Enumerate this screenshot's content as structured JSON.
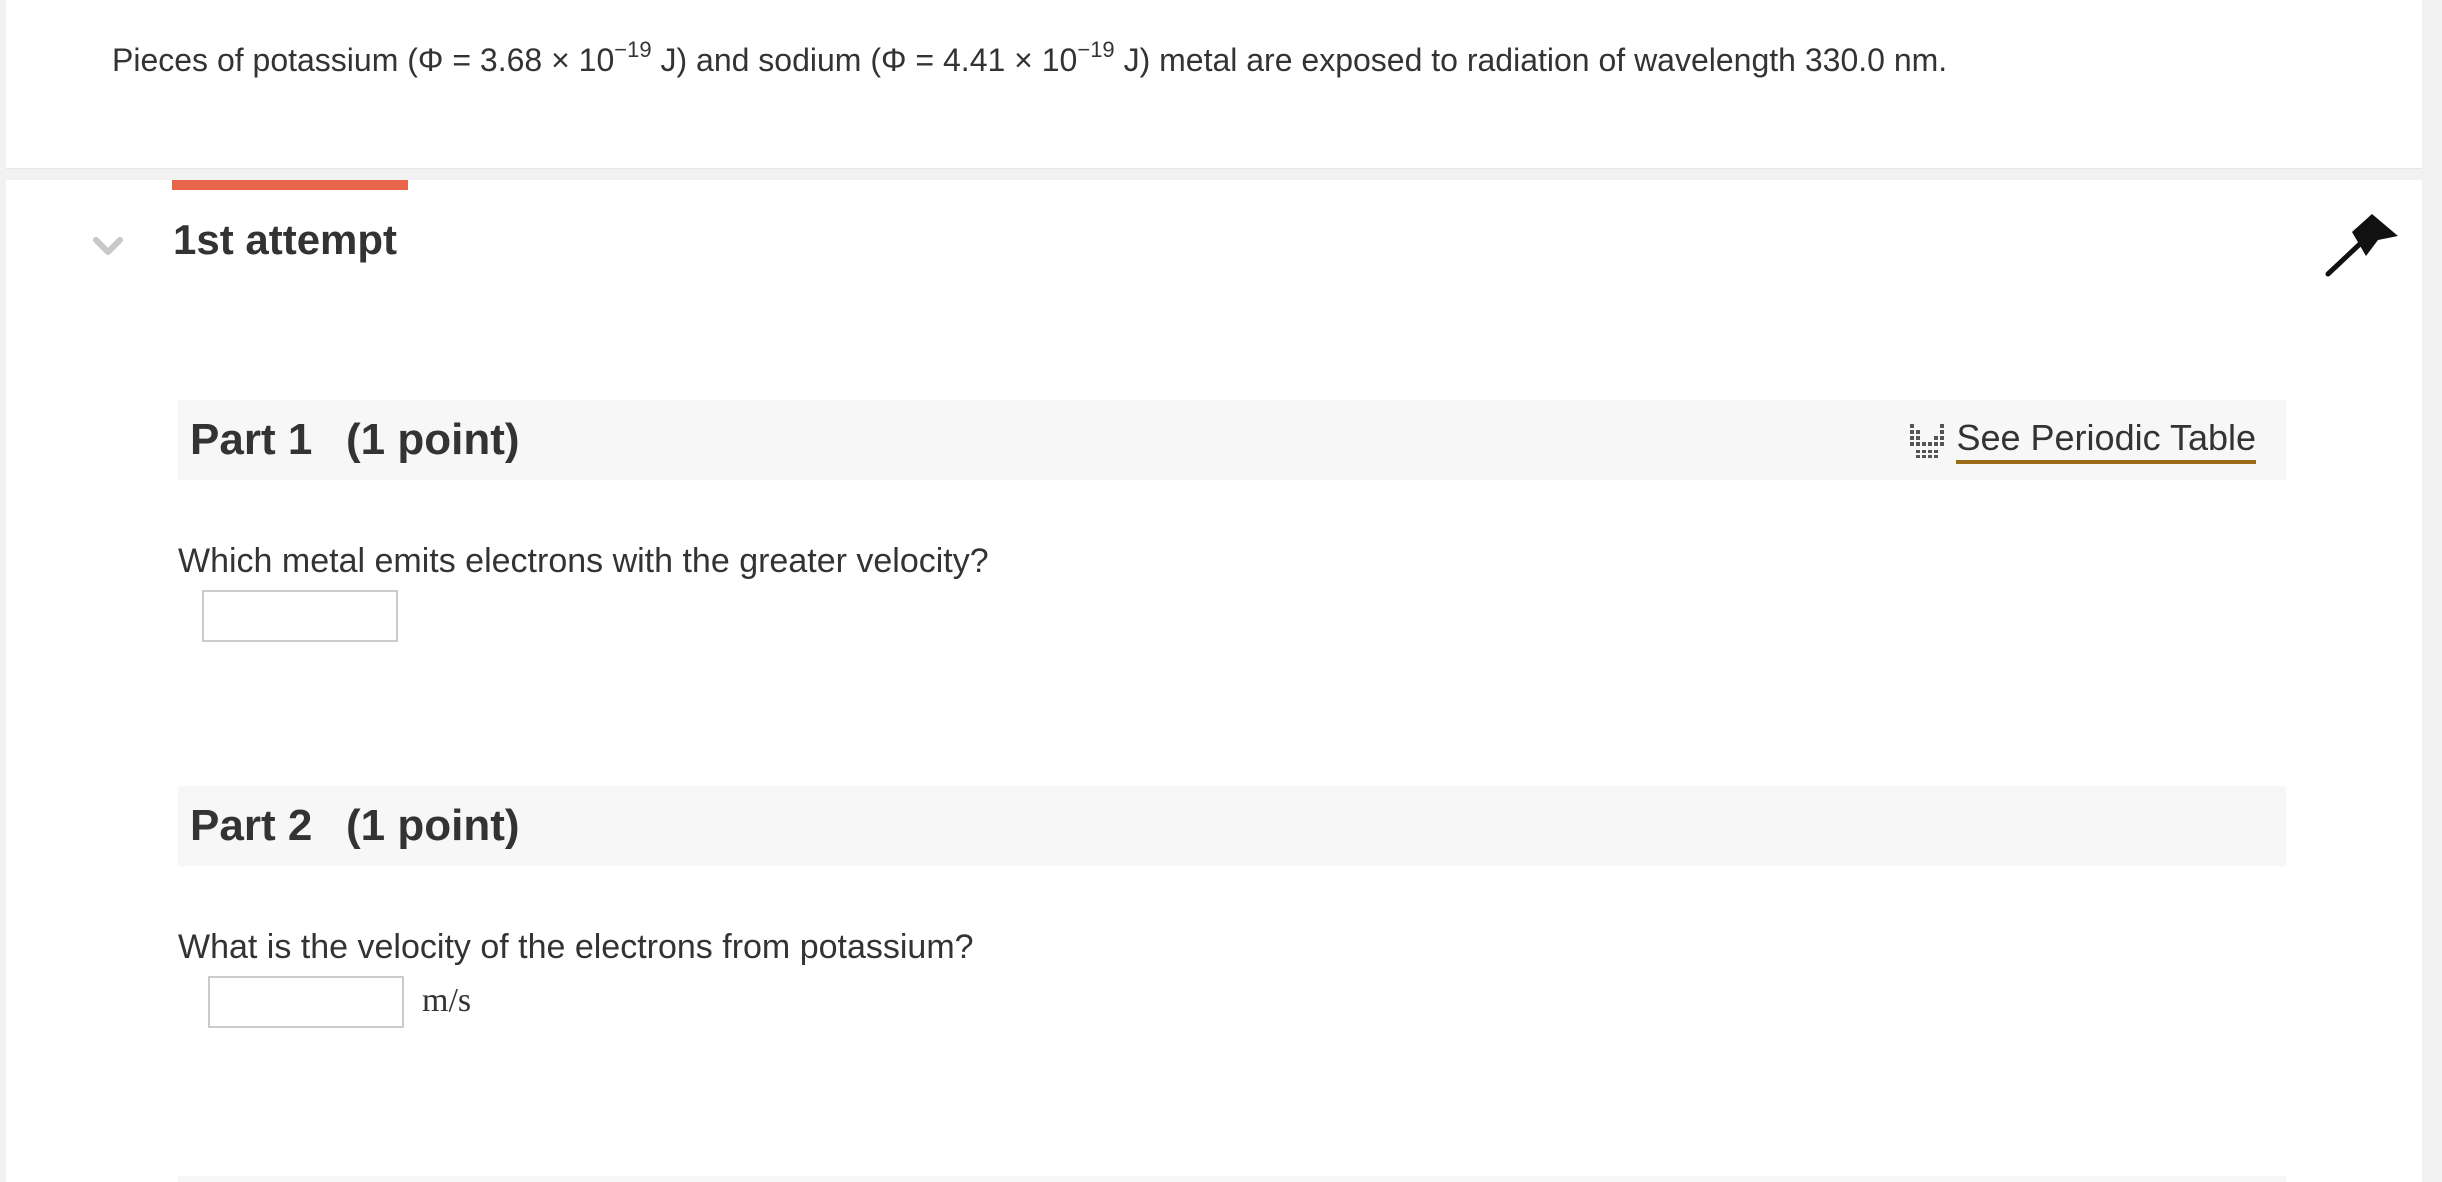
{
  "problem": {
    "text_part1": "Pieces of potassium (Φ = 3.68 × 10",
    "exp1": "−19",
    "text_part2": " J) and sodium (Φ = 4.41 × 10",
    "exp2": "−19",
    "text_part3": " J) metal are exposed to radiation of wavelength 330.0 nm."
  },
  "attempt": {
    "title": "1st attempt",
    "accent_color": "#e8654a"
  },
  "periodic_table": {
    "label": "See Periodic Table",
    "icon": "periodic-table-icon",
    "underline_color": "#9a6c1a"
  },
  "parts": [
    {
      "name": "Part 1",
      "points": "(1 point)",
      "question": "Which metal emits electrons with the greater velocity?",
      "input_value": "",
      "unit": ""
    },
    {
      "name": "Part 2",
      "points": "(1 point)",
      "question": "What is the velocity of the electrons from potassium?",
      "input_value": "",
      "unit": "m/s"
    }
  ],
  "icons": {
    "collapse": "chevron-down-icon",
    "flag": "flag-icon"
  }
}
